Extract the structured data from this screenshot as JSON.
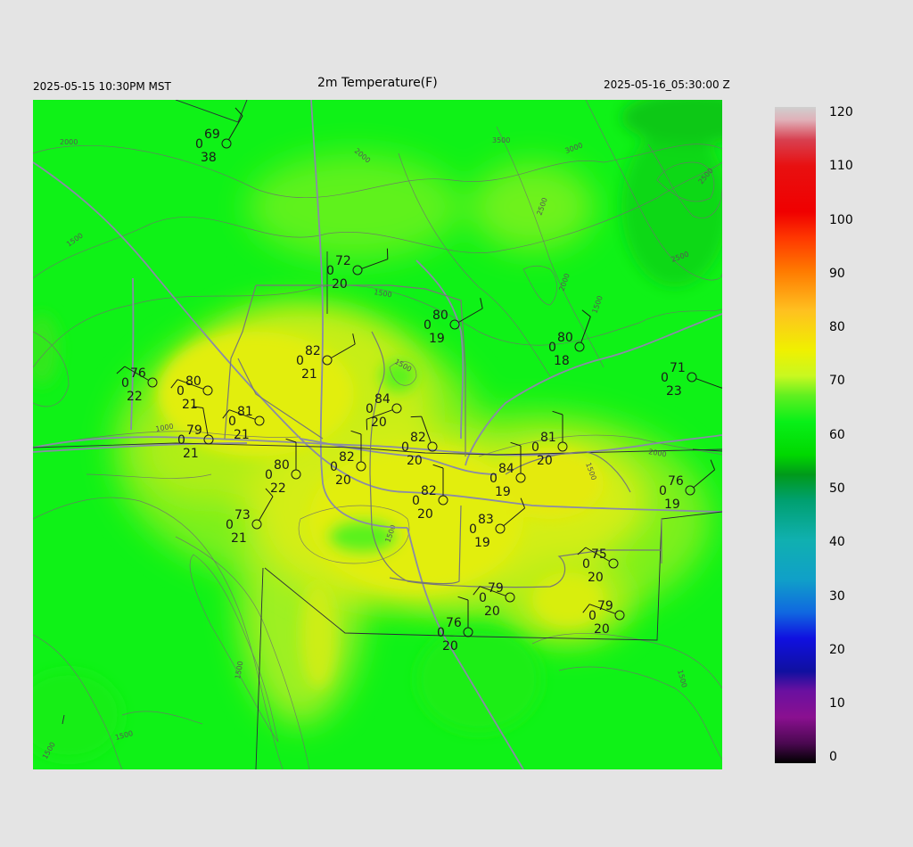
{
  "header": {
    "local_time": "2025-05-15 10:30PM MST",
    "title": "2m Temperature(F)",
    "utc_time": "2025-05-16_05:30:00 Z"
  },
  "colorbar": {
    "labels": [
      "120",
      "110",
      "100",
      "90",
      "80",
      "70",
      "60",
      "50",
      "40",
      "30",
      "20",
      "10",
      "0"
    ]
  },
  "contour_labels": [
    "2000",
    "2000",
    "3500",
    "3000",
    "2500",
    "2500",
    "2500",
    "2000",
    "1500",
    "1500",
    "1500",
    "1000",
    "1500",
    "1500",
    "2000",
    "1500",
    "1500",
    "1500",
    "1500",
    "1500"
  ],
  "stations": [
    {
      "t": "69",
      "d": "38",
      "p": "0"
    },
    {
      "t": "72",
      "d": "20",
      "p": "0"
    },
    {
      "t": "80",
      "d": "19",
      "p": "0"
    },
    {
      "t": "80",
      "d": "18",
      "p": "0"
    },
    {
      "t": "71",
      "d": "23",
      "p": "0"
    },
    {
      "t": "76",
      "d": "22",
      "p": "0"
    },
    {
      "t": "80",
      "d": "21",
      "p": "0"
    },
    {
      "t": "82",
      "d": "21",
      "p": "0"
    },
    {
      "t": "84",
      "d": "20",
      "p": "0"
    },
    {
      "t": "81",
      "d": "21",
      "p": "0"
    },
    {
      "t": "79",
      "d": "21",
      "p": "0"
    },
    {
      "t": "82",
      "d": "20",
      "p": "0"
    },
    {
      "t": "82",
      "d": "20",
      "p": "0"
    },
    {
      "t": "80",
      "d": "22",
      "p": "0"
    },
    {
      "t": "81",
      "d": "20",
      "p": "0"
    },
    {
      "t": "84",
      "d": "19",
      "p": "0"
    },
    {
      "t": "82",
      "d": "20",
      "p": "0"
    },
    {
      "t": "76",
      "d": "19",
      "p": "0"
    },
    {
      "t": "73",
      "d": "21",
      "p": "0"
    },
    {
      "t": "83",
      "d": "19",
      "p": "0"
    },
    {
      "t": "75",
      "d": "20",
      "p": "0"
    },
    {
      "t": "79",
      "d": "20",
      "p": "0"
    },
    {
      "t": "79",
      "d": "20",
      "p": "0"
    },
    {
      "t": "76",
      "d": "20",
      "p": "0"
    }
  ]
}
